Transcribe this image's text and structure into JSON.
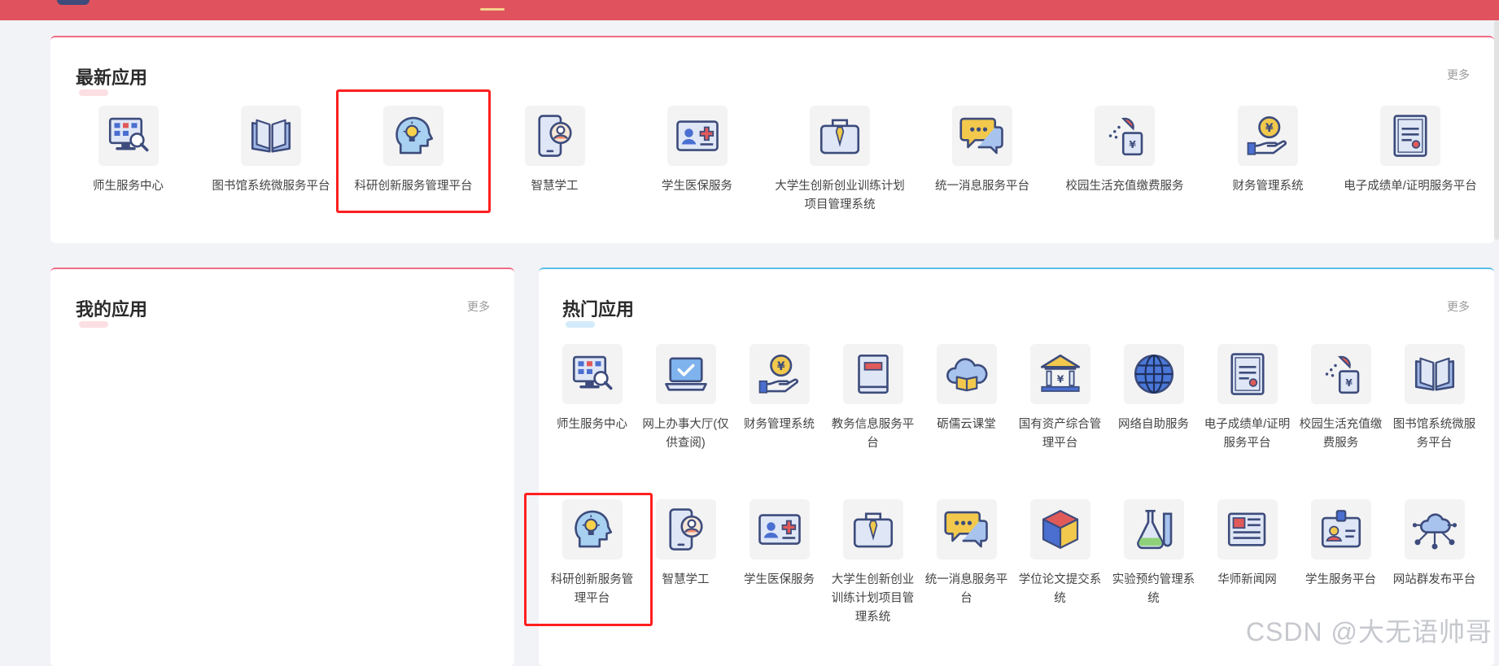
{
  "latest": {
    "title": "最新应用",
    "more": "更多",
    "apps": [
      {
        "name": "师生服务中心",
        "icon": "service-center-icon"
      },
      {
        "name": "图书馆系统微服务平台",
        "icon": "book-icon"
      },
      {
        "name": "科研创新服务管理平台",
        "icon": "idea-head-icon"
      },
      {
        "name": "智慧学工",
        "icon": "mobile-user-icon"
      },
      {
        "name": "学生医保服务",
        "icon": "medical-card-icon"
      },
      {
        "name": "大学生创新创业训练计划项目管理系统",
        "icon": "briefcase-icon"
      },
      {
        "name": "统一消息服务平台",
        "icon": "chat-icon"
      },
      {
        "name": "校园生活充值缴费服务",
        "icon": "payment-shower-icon"
      },
      {
        "name": "财务管理系统",
        "icon": "coin-hand-icon"
      },
      {
        "name": "电子成绩单/证明服务平台",
        "icon": "certificate-icon"
      }
    ]
  },
  "mine": {
    "title": "我的应用",
    "more": "更多"
  },
  "hot": {
    "title": "热门应用",
    "more": "更多",
    "apps": [
      {
        "name": "师生服务中心",
        "icon": "service-center-icon"
      },
      {
        "name": "网上办事大厅(仅供查阅)",
        "icon": "laptop-check-icon"
      },
      {
        "name": "财务管理系统",
        "icon": "coin-hand-icon"
      },
      {
        "name": "教务信息服务平台",
        "icon": "red-book-icon"
      },
      {
        "name": "砺儒云课堂",
        "icon": "cloud-book-icon"
      },
      {
        "name": "国有资产综合管理平台",
        "icon": "bank-icon"
      },
      {
        "name": "网络自助服务",
        "icon": "globe-icon"
      },
      {
        "name": "电子成绩单/证明服务平台",
        "icon": "certificate-icon"
      },
      {
        "name": "校园生活充值缴费服务",
        "icon": "payment-shower-icon"
      },
      {
        "name": "图书馆系统微服务平台",
        "icon": "book-icon"
      },
      {
        "name": "科研创新服务管理平台",
        "icon": "idea-head-icon"
      },
      {
        "name": "智慧学工",
        "icon": "mobile-user-icon"
      },
      {
        "name": "学生医保服务",
        "icon": "medical-card-icon"
      },
      {
        "name": "大学生创新创业训练计划项目管理系统",
        "icon": "briefcase-icon"
      },
      {
        "name": "统一消息服务平台",
        "icon": "chat-icon"
      },
      {
        "name": "学位论文提交系统",
        "icon": "cube-icon"
      },
      {
        "name": "实验预约管理系统",
        "icon": "flask-icon"
      },
      {
        "name": "华师新闻网",
        "icon": "newspaper-icon"
      },
      {
        "name": "学生服务平台",
        "icon": "id-badge-icon"
      },
      {
        "name": "网站群发布平台",
        "icon": "network-cloud-icon"
      }
    ]
  },
  "watermark": "CSDN @大无语帅哥"
}
